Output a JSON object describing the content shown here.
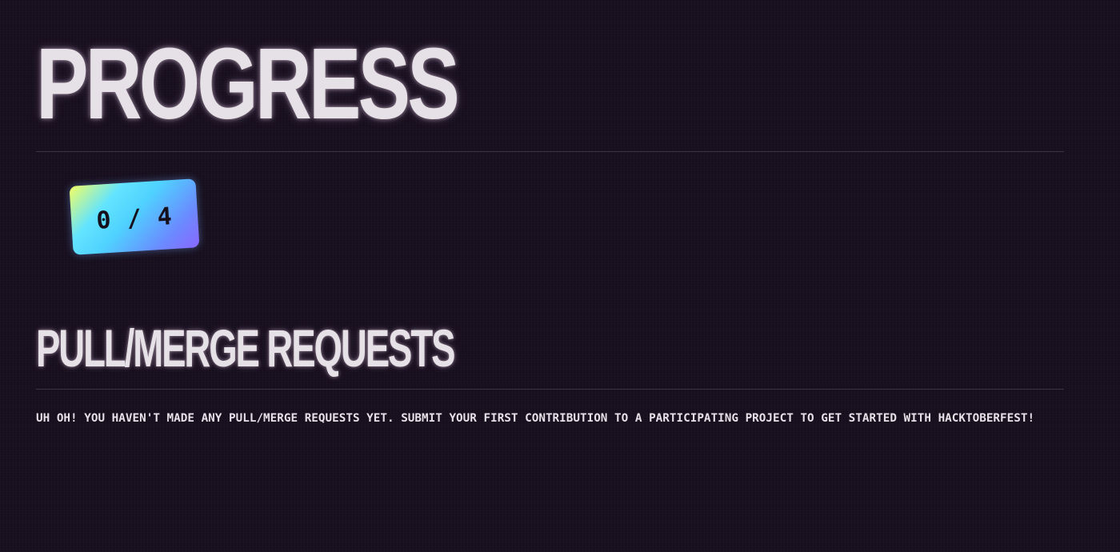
{
  "progress": {
    "title": "PROGRESS",
    "completed": 0,
    "total": 4,
    "badge_text": "0 / 4"
  },
  "pull_requests": {
    "title": "PULL/MERGE REQUESTS",
    "empty_message": "UH OH! YOU HAVEN'T MADE ANY PULL/MERGE REQUESTS YET. SUBMIT YOUR FIRST CONTRIBUTION TO A PARTICIPATING PROJECT TO GET STARTED WITH HACKTOBERFEST!"
  },
  "colors": {
    "background": "#170f1e",
    "text": "#e5e1e6",
    "divider": "#3b3343",
    "badge_gradient": [
      "#f3ff63",
      "#63e4ff",
      "#6a8bff",
      "#8a67ff"
    ]
  }
}
